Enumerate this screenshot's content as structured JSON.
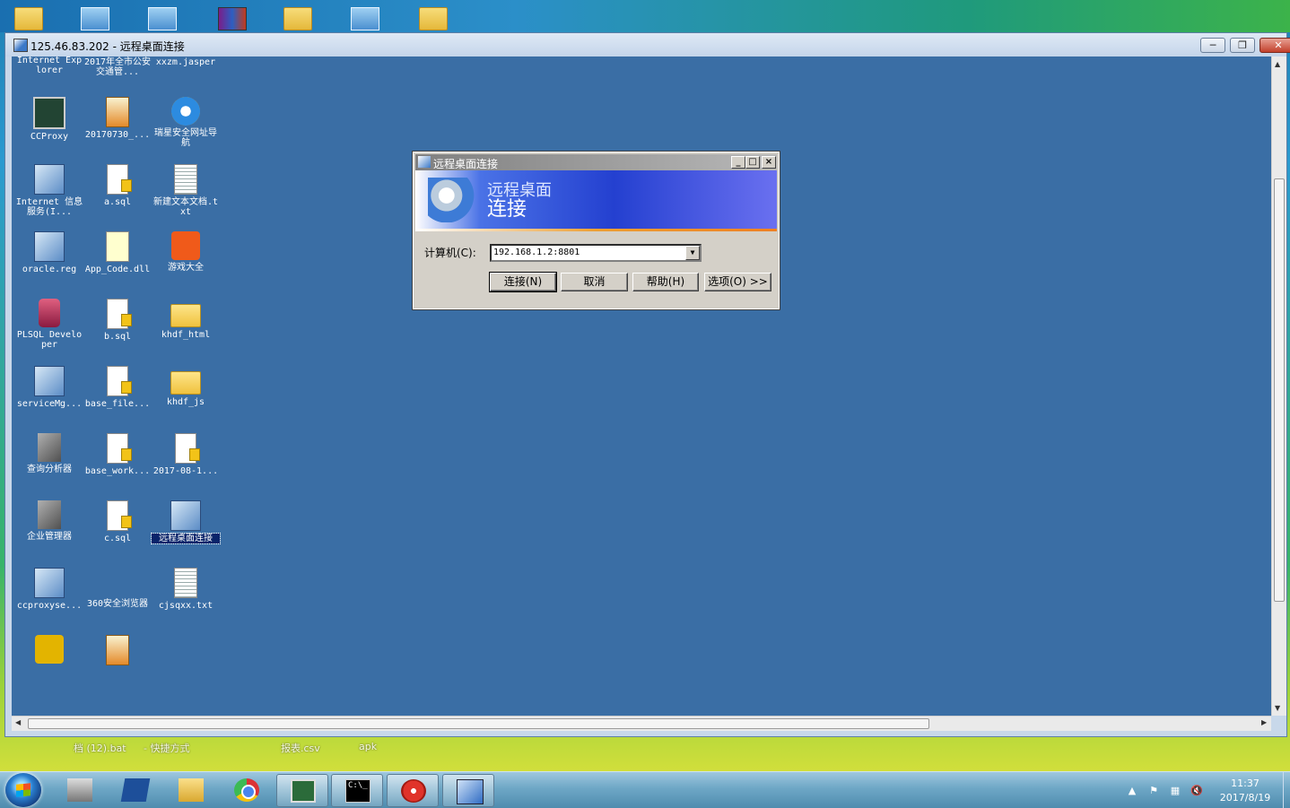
{
  "window": {
    "title": "125.46.83.202 - 远程桌面连接",
    "minimize": "─",
    "restore": "❐",
    "close": "✕"
  },
  "desktop_icons": [
    {
      "label": "Internet Explorer",
      "kind": "ie"
    },
    {
      "label": "2017年全市公安交通管...",
      "kind": "img"
    },
    {
      "label": "xxzm.jasper",
      "kind": "doc"
    },
    {
      "label": "CCProxy",
      "kind": "green"
    },
    {
      "label": "20170730_...",
      "kind": "img"
    },
    {
      "label": "瑞星安全网址导航",
      "kind": "ie"
    },
    {
      "label": "Internet 信息服务(I...",
      "kind": "app"
    },
    {
      "label": "a.sql",
      "kind": "doc"
    },
    {
      "label": "新建文本文档.txt",
      "kind": "txt"
    },
    {
      "label": "oracle.reg",
      "kind": "app"
    },
    {
      "label": "App_Code.dll",
      "kind": "dll"
    },
    {
      "label": "游戏大全",
      "kind": "game"
    },
    {
      "label": "PLSQL Developer",
      "kind": "db"
    },
    {
      "label": "b.sql",
      "kind": "doc"
    },
    {
      "label": "khdf_html",
      "kind": "folder"
    },
    {
      "label": "serviceMg...",
      "kind": "app"
    },
    {
      "label": "base_file...",
      "kind": "doc"
    },
    {
      "label": "khdf_js",
      "kind": "folder"
    },
    {
      "label": "查询分析器",
      "kind": "tool"
    },
    {
      "label": "base_work...",
      "kind": "doc"
    },
    {
      "label": "2017-08-1...",
      "kind": "doc"
    },
    {
      "label": "企业管理器",
      "kind": "tool"
    },
    {
      "label": "c.sql",
      "kind": "doc"
    },
    {
      "label": "远程桌面连接",
      "kind": "app"
    },
    {
      "label": "ccproxyse...",
      "kind": "app"
    },
    {
      "label": "360安全浏览器",
      "kind": "360"
    },
    {
      "label": "cjsqxx.txt",
      "kind": "txt"
    },
    {
      "label": "",
      "kind": "yel"
    },
    {
      "label": "",
      "kind": "img"
    }
  ],
  "dialog": {
    "title": "远程桌面连接",
    "banner_line1": "远程桌面",
    "banner_line2": "连接",
    "computer_label": "计算机(C):",
    "computer_value": "192.168.1.2:8801",
    "connect": "连接(N)",
    "cancel": "取消",
    "help": "帮助(H)",
    "options": "选项(O) >>"
  },
  "host_files": {
    "f1": "档 (12).bat",
    "f2": "- 快捷方式",
    "f3": "报表.csv",
    "f4": "apk"
  },
  "taskbar": {
    "cmd_text": "C:\\_",
    "time": "11:37",
    "date": "2017/8/19"
  },
  "colors": {
    "remote_desktop_bg": "#3a6ea5",
    "dialog_bg": "#d4d0c8"
  }
}
